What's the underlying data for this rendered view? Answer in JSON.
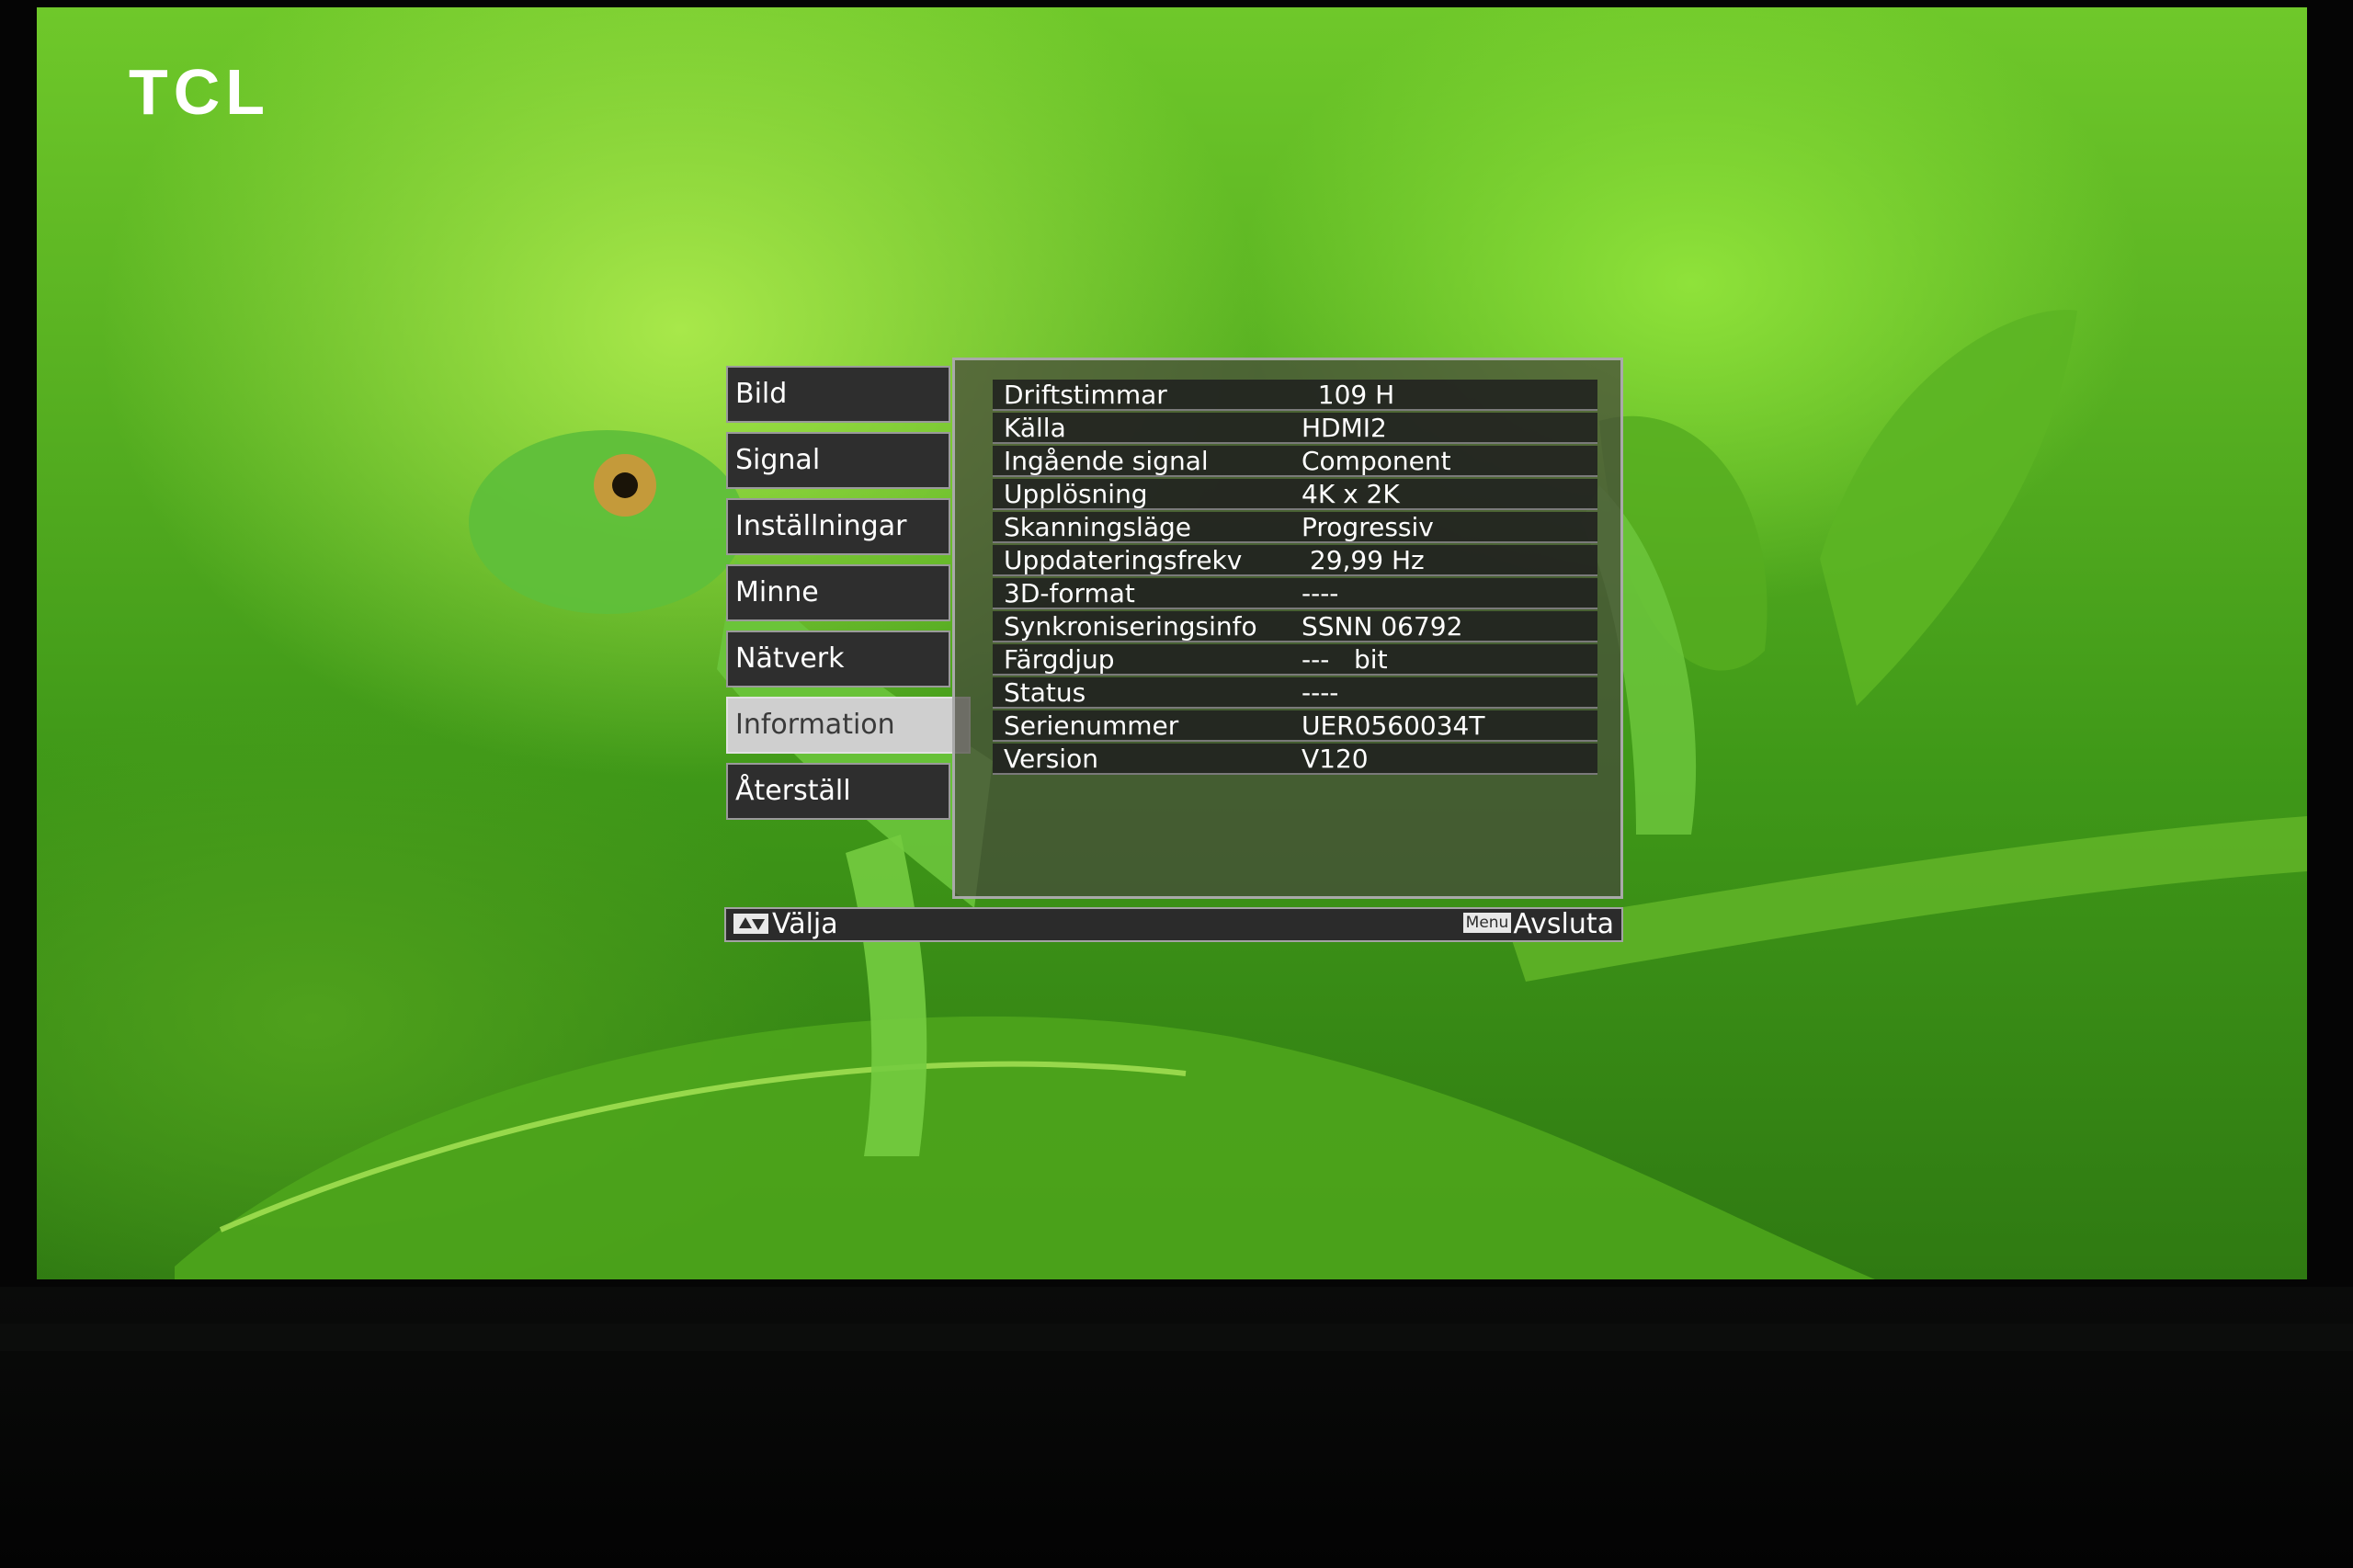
{
  "brand": "TCL",
  "menu": {
    "items": [
      {
        "label": "Bild"
      },
      {
        "label": "Signal"
      },
      {
        "label": "Inställningar"
      },
      {
        "label": "Minne"
      },
      {
        "label": "Nätverk"
      },
      {
        "label": "Information",
        "active": true
      },
      {
        "label": "Återställ"
      }
    ]
  },
  "info": {
    "rows": [
      {
        "label": "Driftstimmar",
        "value": "  109 H"
      },
      {
        "label": "Källa",
        "value": "HDMI2"
      },
      {
        "label": "Ingående signal",
        "value": "Component"
      },
      {
        "label": "Upplösning",
        "value": "4K x 2K"
      },
      {
        "label": "Skanningsläge",
        "value": "Progressiv"
      },
      {
        "label": "Uppdateringsfrekv",
        "value": " 29,99 Hz"
      },
      {
        "label": "3D-format",
        "value": "----"
      },
      {
        "label": "Synkroniseringsinfo",
        "value": "SSNN 06792"
      },
      {
        "label": "Färgdjup",
        "value": "---   bit"
      },
      {
        "label": "Status",
        "value": "----"
      },
      {
        "label": "Serienummer",
        "value": "UER0560034T"
      },
      {
        "label": "Version",
        "value": "V120"
      }
    ]
  },
  "footer": {
    "select_label": "Välja",
    "menu_key": "Menu",
    "exit_label": "Avsluta"
  },
  "colors": {
    "osd_bg": "#2e2e2e",
    "osd_active": "#cfcfcf",
    "background_green": "#6fc82a"
  }
}
